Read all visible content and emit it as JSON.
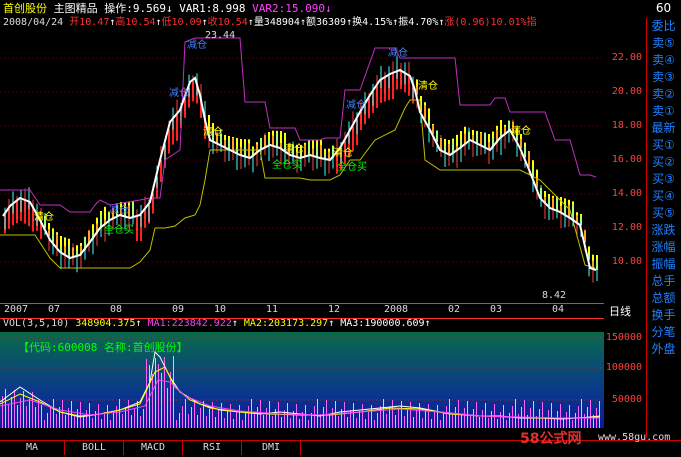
{
  "header": {
    "stock_name": "首创股份",
    "indicator_name": "主图精品",
    "op_label": "操作:9.569",
    "var1_label": "VAR1:8.998",
    "var2_label": "VAR2:15.090"
  },
  "quote": {
    "date": "2008/04/24",
    "open": "开10.47",
    "high": "高10.54",
    "low": "低10.09",
    "close": "收10.54",
    "volume": "量348904",
    "amount": "额36309",
    "turnover": "换4.15%",
    "amplitude": "振4.70%",
    "change": "涨(0.96)10.01%",
    "tail": "指"
  },
  "price_axis": [
    "22.00",
    "20.00",
    "18.00",
    "16.00",
    "14.00",
    "12.00",
    "10.00"
  ],
  "vol_axis": [
    "150000",
    "100000",
    "50000"
  ],
  "time_axis": [
    "2007",
    "07",
    "08",
    "09",
    "10",
    "11",
    "12",
    "2008",
    "02",
    "03",
    "04"
  ],
  "period_label": "日线",
  "vol_header": {
    "title": "VOL(3,5,10)",
    "value": "348904.375",
    "ma1": "MA1:223842.922",
    "ma2": "MA2:203173.297",
    "ma3": "MA3:190000.609"
  },
  "stock_info": "【代码:600008 名称:首创股份】",
  "price_high_label": "23.44",
  "price_low_label": "8.42",
  "annotations": [
    {
      "text": "清仓",
      "color": "#ffff00"
    },
    {
      "text": "全仓买",
      "color": "#00ff00"
    },
    {
      "text": "减仓",
      "color": "#4080ff"
    },
    {
      "text": "减仓",
      "color": "#4080ff"
    },
    {
      "text": "减仓",
      "color": "#4080ff"
    },
    {
      "text": "清仓",
      "color": "#ffff00"
    },
    {
      "text": "清仓",
      "color": "#ffff00"
    },
    {
      "text": "全仓买",
      "color": "#00ff00"
    },
    {
      "text": "清仓",
      "color": "#ffff00"
    },
    {
      "text": "全仓买",
      "color": "#00ff00"
    },
    {
      "text": "减仓",
      "color": "#4080ff"
    },
    {
      "text": "减仓",
      "color": "#4080ff"
    },
    {
      "text": "清仓",
      "color": "#ffff00"
    },
    {
      "text": "清仓",
      "color": "#ffff00"
    }
  ],
  "right_panel": {
    "top_value": "60",
    "items": [
      "委比",
      "卖⑤",
      "卖④",
      "卖③",
      "卖②",
      "卖①",
      "最新",
      "买①",
      "买②",
      "买③",
      "买④",
      "买⑤",
      "涨跌",
      "涨幅",
      "振幅",
      "总手",
      "总额",
      "换手",
      "分笔",
      "外盘"
    ]
  },
  "bottom_tabs": [
    "MA",
    "BOLL",
    "MACD",
    "RSI",
    "DMI"
  ],
  "watermark": {
    "brand": "58公式网",
    "url": "www.58gu.com"
  },
  "colors": {
    "up": "#ff2020",
    "down": "#ffff00",
    "accent": "#ff3030",
    "grid": "#c00000"
  }
}
